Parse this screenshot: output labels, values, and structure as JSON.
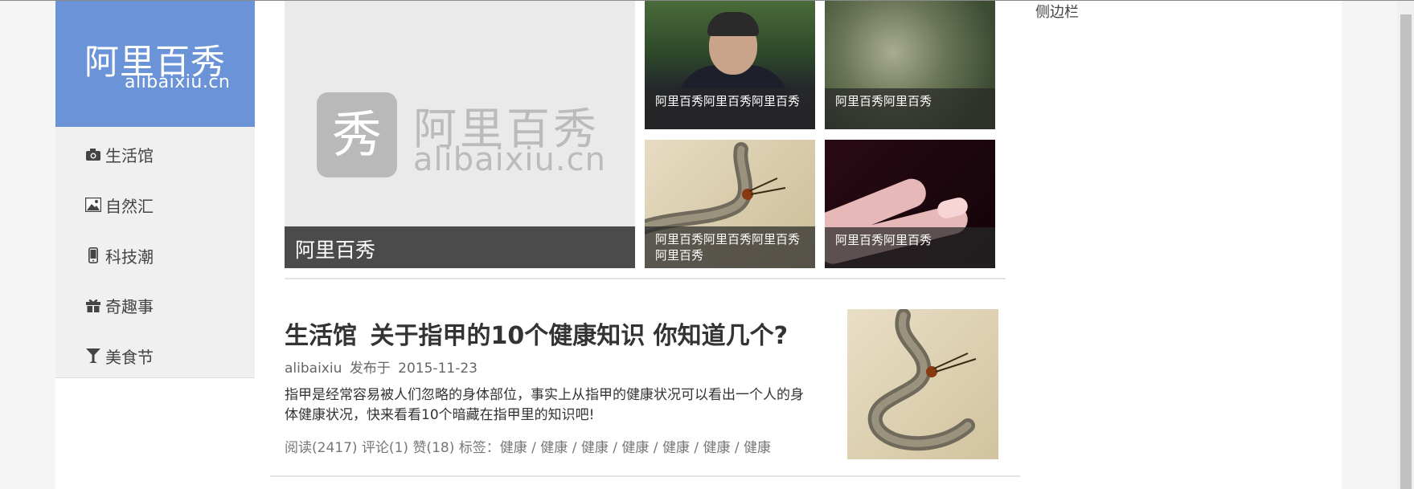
{
  "logo": {
    "name_cn": "阿里百秀",
    "name_en": "alibaixiu.cn"
  },
  "nav": [
    {
      "label": "生活馆",
      "icon": "camera-icon"
    },
    {
      "label": "自然汇",
      "icon": "picture-icon"
    },
    {
      "label": "科技潮",
      "icon": "phone-icon"
    },
    {
      "label": "奇趣事",
      "icon": "gift-icon"
    },
    {
      "label": "美食节",
      "icon": "cocktail-icon"
    }
  ],
  "focus": {
    "main_caption": "阿里百秀",
    "watermark_char": "秀",
    "watermark_cn": "阿里百秀",
    "watermark_en": "alibaixiu.cn",
    "thumbs": [
      {
        "caption": "阿里百秀阿里百秀阿里百秀"
      },
      {
        "caption": "阿里百秀阿里百秀"
      },
      {
        "caption": "阿里百秀阿里百秀阿里百秀阿里百秀"
      },
      {
        "caption": "阿里百秀阿里百秀"
      }
    ]
  },
  "article": {
    "category": "生活馆",
    "title": "关于指甲的10个健康知识 你知道几个?",
    "author": "alibaixiu",
    "published_label": "发布于",
    "date": "2015-11-23",
    "summary": "指甲是经常容易被人们忽略的身体部位，事实上从指甲的健康状况可以看出一个人的身体健康状况，快来看看10个暗藏在指甲里的知识吧!",
    "reads": "阅读(2417)",
    "comments": "评论(1)",
    "likes": "赞(18)",
    "tags_label": "标签：",
    "tags": [
      "健康",
      "健康",
      "健康",
      "健康",
      "健康",
      "健康",
      "健康"
    ]
  },
  "sidebar": {
    "title": "侧边栏"
  }
}
